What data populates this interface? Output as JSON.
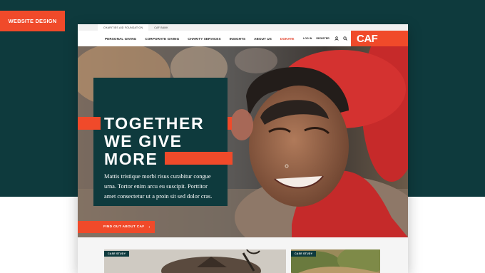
{
  "tag": {
    "label": "WEBSITE DESIGN"
  },
  "topbar": {
    "tabs": [
      "CHARITIES AID FOUNDATION",
      "CAF BANK"
    ]
  },
  "nav": {
    "items": [
      "PERSONAL GIVING",
      "CORPORATE GIVING",
      "CHARITY SERVICES",
      "INSIGHTS",
      "ABOUT US",
      "DONATE"
    ],
    "login": "LOG IN",
    "register": "REGISTER",
    "logo": "CAF"
  },
  "hero": {
    "headline": [
      "TOGETHER",
      "WE GIVE",
      "MORE"
    ],
    "body": "Mattis tristique morbi risus curabitur congue urna. Tortor enim arcu eu suscipit. Porttitor amet consectetur ut a proin sit sed dolor cras.",
    "cta": "FIND OUT ABOUT CAF"
  },
  "cards": [
    {
      "badge": "CASE STUDY"
    },
    {
      "badge": "CASE STUDY"
    }
  ],
  "colors": {
    "dark_teal": "#0e3a3d",
    "accent": "#f04a2a"
  },
  "icons": [
    "user-icon",
    "search-icon",
    "arrow-right-icon"
  ]
}
